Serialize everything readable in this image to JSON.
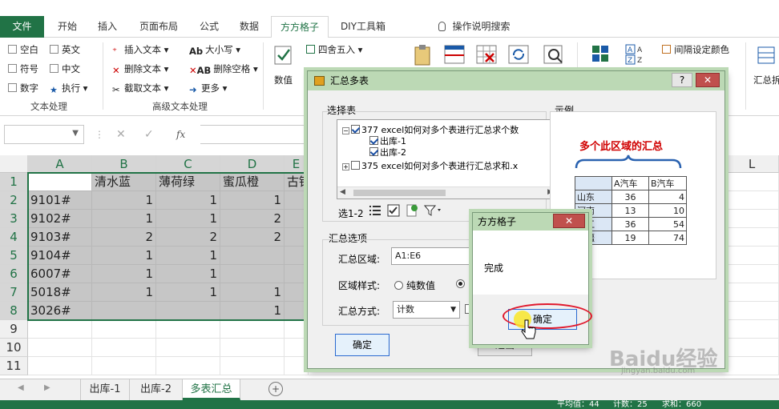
{
  "ribbon_tabs": [
    "文件",
    "开始",
    "插入",
    "页面布局",
    "公式",
    "数据",
    "方方格子",
    "DIY工具箱"
  ],
  "tell_me": "操作说明搜索",
  "ribbon": {
    "text_group": {
      "items": [
        "空白",
        "英文",
        "符号",
        "中文",
        "数字",
        "执行"
      ],
      "label": "文本处理"
    },
    "adv_group": {
      "items": [
        "插入文本",
        "删除文本",
        "截取文本",
        "大小写",
        "删除空格",
        "更多"
      ],
      "label": "高级文本处理"
    },
    "right_items": [
      "四舍五入",
      "数值",
      "间隔设定颜色",
      "汇总拆分"
    ]
  },
  "formula_bar": {
    "fx": "fx"
  },
  "columns": [
    "A",
    "B",
    "C",
    "D",
    "E",
    "L"
  ],
  "rows": [
    {
      "n": "1",
      "a": "",
      "b": "清水蓝",
      "c": "薄荷绿",
      "d": "蜜瓜橙",
      "e": "古铜"
    },
    {
      "n": "2",
      "a": "9101#",
      "b": "1",
      "c": "1",
      "d": "1",
      "e": ""
    },
    {
      "n": "3",
      "a": "9102#",
      "b": "1",
      "c": "1",
      "d": "2",
      "e": ""
    },
    {
      "n": "4",
      "a": "9103#",
      "b": "2",
      "c": "2",
      "d": "2",
      "e": ""
    },
    {
      "n": "5",
      "a": "9104#",
      "b": "1",
      "c": "1",
      "d": "",
      "e": ""
    },
    {
      "n": "6",
      "a": "6007#",
      "b": "1",
      "c": "1",
      "d": "",
      "e": ""
    },
    {
      "n": "7",
      "a": "5018#",
      "b": "1",
      "c": "1",
      "d": "1",
      "e": ""
    },
    {
      "n": "8",
      "a": "3026#",
      "b": "",
      "c": "",
      "d": "1",
      "e": ""
    },
    {
      "n": "9",
      "a": "",
      "b": "",
      "c": "",
      "d": "",
      "e": ""
    },
    {
      "n": "10",
      "a": "",
      "b": "",
      "c": "",
      "d": "",
      "e": ""
    },
    {
      "n": "11",
      "a": "",
      "b": "",
      "c": "",
      "d": "",
      "e": ""
    }
  ],
  "sheet_tabs": [
    "出库-1",
    "出库-2",
    "多表汇总"
  ],
  "status": {
    "avg": "平均值：44",
    "count": "计数：25",
    "sum": "求和：660"
  },
  "dialog": {
    "title": "汇总多表",
    "help": "?",
    "select_label": "选择表",
    "tree": [
      "377 excel如何对多个表进行汇总求个数",
      "出库-1",
      "出库-2",
      "375 excel如何对多个表进行汇总求和.x"
    ],
    "select_count": "选1-2",
    "example_label": "示例",
    "example_title": "多个此区域的汇总",
    "example_table": {
      "headers": [
        "",
        "A汽车",
        "B汽车"
      ],
      "rows": [
        [
          "山东",
          "36",
          "4"
        ],
        [
          "河南",
          "13",
          "10"
        ],
        [
          "浙江",
          "36",
          "54"
        ],
        [
          "新疆",
          "19",
          "74"
        ]
      ]
    },
    "options_label": "汇总选项",
    "range_label": "汇总区域:",
    "range_value": "A1:E6",
    "style_label": "区域样式:",
    "style_option": "纯数值",
    "method_label": "汇总方式:",
    "method_value": "计数",
    "ok": "确定",
    "other_btn": "退出"
  },
  "msgbox": {
    "title": "方方格子",
    "message": "完成",
    "ok": "确定",
    "close": "✕"
  },
  "watermark": "Baidu经验",
  "watermark_sub": "jingyan.baidu.com"
}
